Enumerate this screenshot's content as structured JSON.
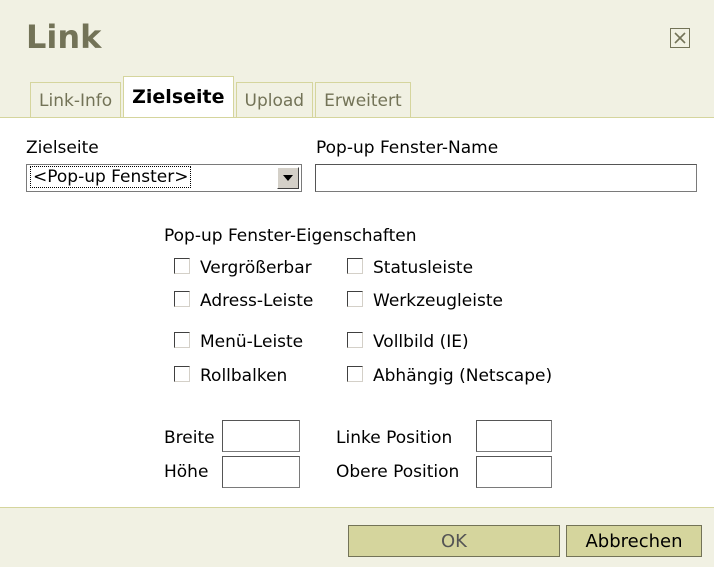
{
  "dialog": {
    "title": "Link",
    "close_glyph": "×"
  },
  "tabs": [
    {
      "label": "Link-Info"
    },
    {
      "label": "Zielseite"
    },
    {
      "label": "Upload"
    },
    {
      "label": "Erweitert"
    }
  ],
  "form": {
    "target_label": "Zielseite",
    "target_value": "<Pop-up Fenster>",
    "popup_name_label": "Pop-up Fenster-Name",
    "popup_name_value": "",
    "props_label": "Pop-up Fenster-Eigenschaften",
    "checkboxes": [
      {
        "label": "Vergrößerbar",
        "checked": false
      },
      {
        "label": "Statusleiste",
        "checked": false
      },
      {
        "label": "Adress-Leiste",
        "checked": false
      },
      {
        "label": "Werkzeugleiste",
        "checked": false
      },
      {
        "label": "Menü-Leiste",
        "checked": false
      },
      {
        "label": "Vollbild (IE)",
        "checked": false
      },
      {
        "label": "Rollbalken",
        "checked": false
      },
      {
        "label": "Abhängig (Netscape)",
        "checked": false
      }
    ],
    "width_label": "Breite",
    "height_label": "Höhe",
    "left_label": "Linke Position",
    "top_label": "Obere Position"
  },
  "footer": {
    "ok_label": "OK",
    "cancel_label": "Abbrechen"
  }
}
